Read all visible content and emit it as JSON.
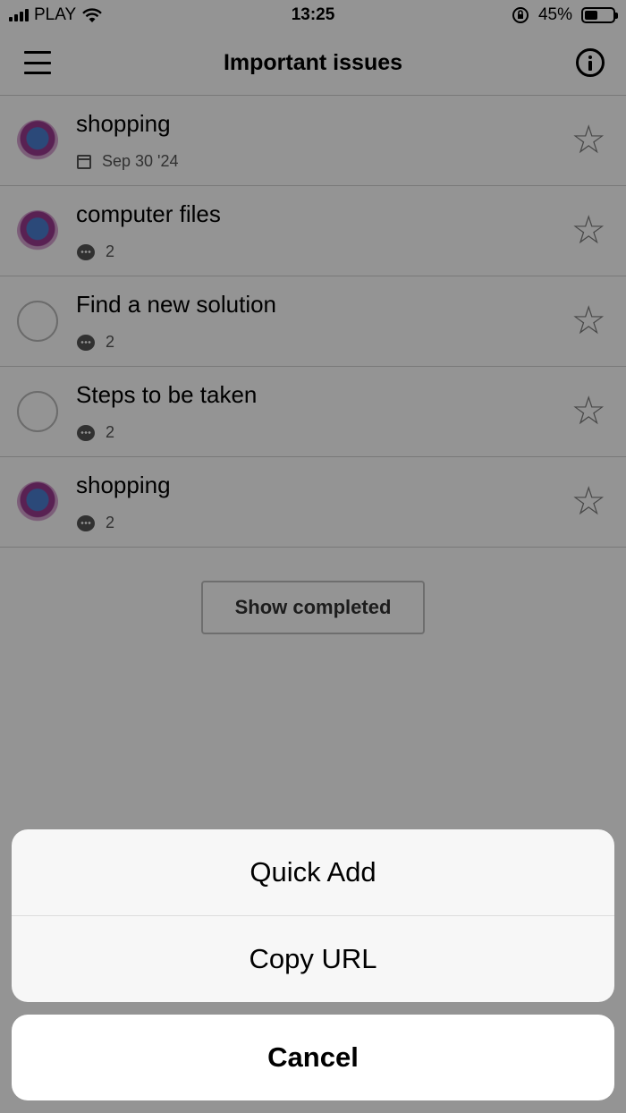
{
  "status_bar": {
    "carrier": "PLAY",
    "time": "13:25",
    "battery": "45%",
    "battery_level": 0.45
  },
  "header": {
    "title": "Important issues",
    "menu_icon": "hamburger-icon",
    "info_icon": "info-icon"
  },
  "tasks": [
    {
      "label": "shopping",
      "meta": "Sep 30 '24",
      "meta_icon": "calendar-icon",
      "check": "avatar"
    },
    {
      "label": "computer files",
      "meta": "2",
      "meta_icon": "comment-icon",
      "check": "avatar"
    },
    {
      "label": "Find a new solution",
      "meta": "2",
      "meta_icon": "comment-icon",
      "check": "circle"
    },
    {
      "label": "Steps to be taken",
      "meta": "2",
      "meta_icon": "comment-icon",
      "check": "circle"
    },
    {
      "label": "shopping",
      "meta": "2",
      "meta_icon": "comment-icon",
      "check": "avatar"
    }
  ],
  "show_completed_label": "Show completed",
  "action_sheet": {
    "quick_add": "Quick Add",
    "copy_url": "Copy URL",
    "cancel": "Cancel"
  }
}
